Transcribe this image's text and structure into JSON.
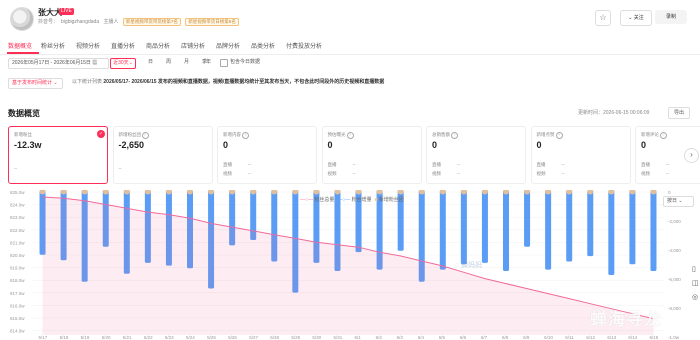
{
  "header": {
    "anchor_name": "张大大",
    "live_badge": "LIVE",
    "account_label": "抖音号：",
    "account_id": "bigbigzhangdada",
    "sub_items": [
      "主播人",
      "新星视频带货带货榜第7名",
      "新星视频带货日榜第8名"
    ],
    "collect_icon": "bookmark-icon",
    "follow_label": "关注",
    "record_label": "录制"
  },
  "tabs": [
    "数据概览",
    "粉丝分析",
    "视频分析",
    "直播分析",
    "商品分析",
    "店铺分析",
    "品牌分析",
    "品类分析",
    "付费投放分析"
  ],
  "filters": {
    "date_range": "2026年05月17日 - 2026年06月15日",
    "active_period": "近30天",
    "periods": [
      "日",
      "周",
      "月",
      "季",
      "年"
    ],
    "include_today": "包含今日数据",
    "live_select": "基于发布时间统计",
    "notice_prefix": "以下统计列表",
    "notice_range": "2026/05/17- 2026/06/15",
    "notice_rest": "发布的视频和直播数据，视频/直播数据均统计至其发布当天，不包含此时间段外的历史视频和直播数据"
  },
  "overview": {
    "title": "数据概览",
    "update_time": "更新时间：2026-06-15 00:06:09",
    "export": "导出",
    "cards": [
      {
        "title": "新增粉丝",
        "value": "-12.3w",
        "sub": [
          "--"
        ]
      },
      {
        "title": "新增粉丝团",
        "value": "-2,650",
        "sub": [
          "--"
        ]
      },
      {
        "title": "新增内容",
        "value": "0",
        "sub": [
          "直播",
          "视频"
        ],
        "sub_vals": [
          "--",
          "--"
        ]
      },
      {
        "title": "预估曝光",
        "value": "0",
        "sub": [
          "直播",
          "视频"
        ],
        "sub_vals": [
          "--",
          "--"
        ]
      },
      {
        "title": "总销售额",
        "value": "0",
        "sub": [
          "直播",
          "视频"
        ],
        "sub_vals": [
          "--",
          "--"
        ]
      },
      {
        "title": "新增点赞",
        "value": "0",
        "sub": [
          "直播",
          "视频"
        ],
        "sub_vals": [
          "--",
          "--"
        ]
      },
      {
        "title": "新增评论",
        "value": "0",
        "sub": [
          "直播",
          "视频"
        ],
        "sub_vals": [
          "--",
          "--"
        ]
      }
    ]
  },
  "chart_controls": {
    "legend": [
      "粉丝总量",
      "粉丝增量",
      "新增粉丝团"
    ],
    "unit": "按日"
  },
  "watermark": "蝉海寻龙",
  "colors": {
    "accent": "#ff2e56",
    "bar": "#5b9cf5",
    "line": "#f06a9a",
    "dot": "#f7c58e"
  },
  "chart_data": {
    "type": "bar",
    "categories": [
      "5/17",
      "5/18",
      "5/19",
      "5/20",
      "5/21",
      "5/22",
      "5/23",
      "5/24",
      "5/25",
      "5/26",
      "5/27",
      "5/28",
      "5/29",
      "5/30",
      "5/31",
      "6/1",
      "6/2",
      "6/3",
      "6/4",
      "6/5",
      "6/6",
      "6/7",
      "6/8",
      "6/9",
      "6/10",
      "6/11",
      "6/12",
      "6/13",
      "6/14",
      "6/15"
    ],
    "left_axis_ticks": [
      "825.0w",
      "824.0w",
      "823.0w",
      "822.0w",
      "821.0w",
      "820.0w",
      "819.0w",
      "818.0w",
      "817.0w",
      "816.0w",
      "815.0w",
      "814.0w"
    ],
    "right_axis_ticks": [
      "0",
      "-2,000",
      "-4,000",
      "-6,000",
      "-8,000",
      "-1.0w"
    ],
    "series": [
      {
        "name": "粉丝增量",
        "type": "bar",
        "values": [
          -4800,
          -5200,
          -6800,
          -4200,
          -6200,
          -5400,
          -5600,
          -5800,
          -7300,
          -4100,
          -3700,
          -5300,
          -7600,
          -5400,
          -6000,
          -4600,
          -5900,
          -4500,
          -6800,
          -5900,
          -5500,
          -5400,
          -6000,
          -4200,
          -5900,
          -5300,
          -4900,
          -6300,
          -5500,
          -6000
        ]
      },
      {
        "name": "粉丝总量",
        "type": "line",
        "values": [
          824.6,
          824.5,
          824.3,
          824.0,
          823.7,
          823.4,
          823.2,
          822.9,
          822.5,
          822.2,
          821.9,
          821.6,
          821.3,
          821.0,
          820.8,
          820.6,
          820.2,
          819.9,
          819.5,
          819.1,
          818.6,
          818.1,
          817.7,
          817.3,
          816.9,
          816.5,
          816.1,
          815.7,
          815.3,
          814.9
        ]
      },
      {
        "name": "新增粉丝团",
        "type": "dot",
        "values": [
          0,
          0,
          0,
          0,
          0,
          0,
          0,
          0,
          0,
          0,
          0,
          0,
          0,
          0,
          0,
          0,
          0,
          0,
          0,
          0,
          0,
          0,
          0,
          0,
          0,
          0,
          0,
          0,
          0,
          0
        ]
      }
    ],
    "ylim_left": [
      814,
      825
    ],
    "ylim_right": [
      -10000,
      0
    ]
  }
}
